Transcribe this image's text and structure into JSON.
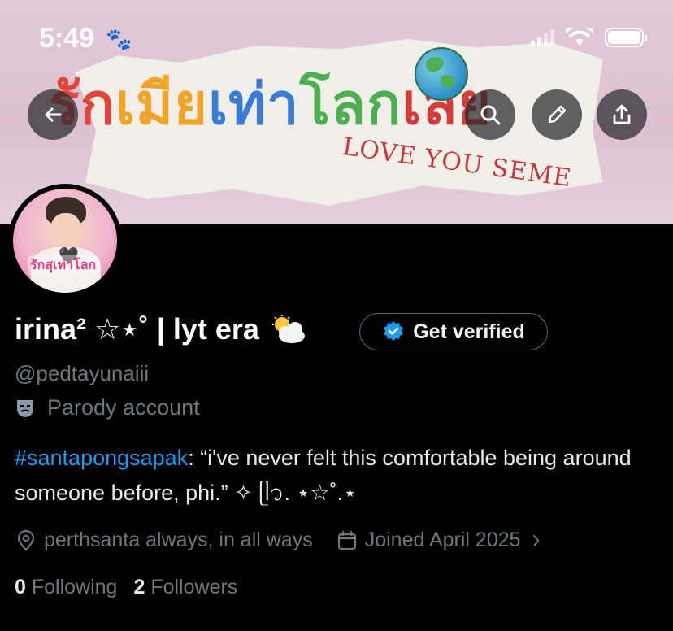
{
  "status_bar": {
    "time": "5:49"
  },
  "banner": {
    "title_text": "รักเมียเท่าโลกเลย",
    "subtitle": "LOVE YOU SEME"
  },
  "header_actions": {
    "back_icon": "arrow-left-icon",
    "search_icon": "search-icon",
    "edit_icon": "pencil-icon",
    "share_icon": "share-icon"
  },
  "avatar": {
    "overlay_text": "รักสุเท่าโลก"
  },
  "profile": {
    "display_name": "irina² ☆⋆˚ | lyt era",
    "handle": "@pedtayunaiii",
    "label": "Parody account",
    "bio_hashtag": "#santapongsapak",
    "bio_text": ": “i've never felt this comfortable being around someone before, phi.” ✧ ᥫ᭡. ⋆☆˚.⋆",
    "location": "perthsanta always, in all ways",
    "joined": "Joined April 2025"
  },
  "verify_button": {
    "label": "Get verified"
  },
  "stats": {
    "following_count": "0",
    "following_label": "Following",
    "followers_count": "2",
    "followers_label": "Followers"
  },
  "colors": {
    "accent": "#1d9bf0",
    "muted": "#71767b",
    "background": "#000000"
  }
}
